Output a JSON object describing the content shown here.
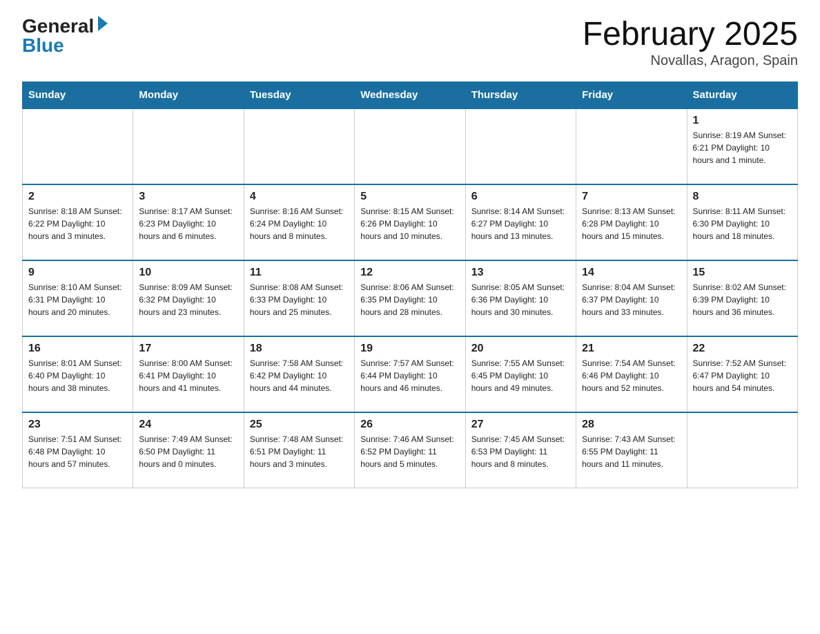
{
  "logo": {
    "general": "General",
    "blue": "Blue"
  },
  "title": {
    "month": "February 2025",
    "location": "Novallas, Aragon, Spain"
  },
  "header": {
    "days": [
      "Sunday",
      "Monday",
      "Tuesday",
      "Wednesday",
      "Thursday",
      "Friday",
      "Saturday"
    ]
  },
  "weeks": [
    [
      {
        "day": "",
        "info": ""
      },
      {
        "day": "",
        "info": ""
      },
      {
        "day": "",
        "info": ""
      },
      {
        "day": "",
        "info": ""
      },
      {
        "day": "",
        "info": ""
      },
      {
        "day": "",
        "info": ""
      },
      {
        "day": "1",
        "info": "Sunrise: 8:19 AM\nSunset: 6:21 PM\nDaylight: 10 hours and 1 minute."
      }
    ],
    [
      {
        "day": "2",
        "info": "Sunrise: 8:18 AM\nSunset: 6:22 PM\nDaylight: 10 hours and 3 minutes."
      },
      {
        "day": "3",
        "info": "Sunrise: 8:17 AM\nSunset: 6:23 PM\nDaylight: 10 hours and 6 minutes."
      },
      {
        "day": "4",
        "info": "Sunrise: 8:16 AM\nSunset: 6:24 PM\nDaylight: 10 hours and 8 minutes."
      },
      {
        "day": "5",
        "info": "Sunrise: 8:15 AM\nSunset: 6:26 PM\nDaylight: 10 hours and 10 minutes."
      },
      {
        "day": "6",
        "info": "Sunrise: 8:14 AM\nSunset: 6:27 PM\nDaylight: 10 hours and 13 minutes."
      },
      {
        "day": "7",
        "info": "Sunrise: 8:13 AM\nSunset: 6:28 PM\nDaylight: 10 hours and 15 minutes."
      },
      {
        "day": "8",
        "info": "Sunrise: 8:11 AM\nSunset: 6:30 PM\nDaylight: 10 hours and 18 minutes."
      }
    ],
    [
      {
        "day": "9",
        "info": "Sunrise: 8:10 AM\nSunset: 6:31 PM\nDaylight: 10 hours and 20 minutes."
      },
      {
        "day": "10",
        "info": "Sunrise: 8:09 AM\nSunset: 6:32 PM\nDaylight: 10 hours and 23 minutes."
      },
      {
        "day": "11",
        "info": "Sunrise: 8:08 AM\nSunset: 6:33 PM\nDaylight: 10 hours and 25 minutes."
      },
      {
        "day": "12",
        "info": "Sunrise: 8:06 AM\nSunset: 6:35 PM\nDaylight: 10 hours and 28 minutes."
      },
      {
        "day": "13",
        "info": "Sunrise: 8:05 AM\nSunset: 6:36 PM\nDaylight: 10 hours and 30 minutes."
      },
      {
        "day": "14",
        "info": "Sunrise: 8:04 AM\nSunset: 6:37 PM\nDaylight: 10 hours and 33 minutes."
      },
      {
        "day": "15",
        "info": "Sunrise: 8:02 AM\nSunset: 6:39 PM\nDaylight: 10 hours and 36 minutes."
      }
    ],
    [
      {
        "day": "16",
        "info": "Sunrise: 8:01 AM\nSunset: 6:40 PM\nDaylight: 10 hours and 38 minutes."
      },
      {
        "day": "17",
        "info": "Sunrise: 8:00 AM\nSunset: 6:41 PM\nDaylight: 10 hours and 41 minutes."
      },
      {
        "day": "18",
        "info": "Sunrise: 7:58 AM\nSunset: 6:42 PM\nDaylight: 10 hours and 44 minutes."
      },
      {
        "day": "19",
        "info": "Sunrise: 7:57 AM\nSunset: 6:44 PM\nDaylight: 10 hours and 46 minutes."
      },
      {
        "day": "20",
        "info": "Sunrise: 7:55 AM\nSunset: 6:45 PM\nDaylight: 10 hours and 49 minutes."
      },
      {
        "day": "21",
        "info": "Sunrise: 7:54 AM\nSunset: 6:46 PM\nDaylight: 10 hours and 52 minutes."
      },
      {
        "day": "22",
        "info": "Sunrise: 7:52 AM\nSunset: 6:47 PM\nDaylight: 10 hours and 54 minutes."
      }
    ],
    [
      {
        "day": "23",
        "info": "Sunrise: 7:51 AM\nSunset: 6:48 PM\nDaylight: 10 hours and 57 minutes."
      },
      {
        "day": "24",
        "info": "Sunrise: 7:49 AM\nSunset: 6:50 PM\nDaylight: 11 hours and 0 minutes."
      },
      {
        "day": "25",
        "info": "Sunrise: 7:48 AM\nSunset: 6:51 PM\nDaylight: 11 hours and 3 minutes."
      },
      {
        "day": "26",
        "info": "Sunrise: 7:46 AM\nSunset: 6:52 PM\nDaylight: 11 hours and 5 minutes."
      },
      {
        "day": "27",
        "info": "Sunrise: 7:45 AM\nSunset: 6:53 PM\nDaylight: 11 hours and 8 minutes."
      },
      {
        "day": "28",
        "info": "Sunrise: 7:43 AM\nSunset: 6:55 PM\nDaylight: 11 hours and 11 minutes."
      },
      {
        "day": "",
        "info": ""
      }
    ]
  ]
}
